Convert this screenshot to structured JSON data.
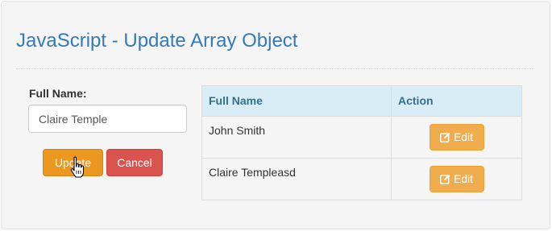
{
  "page": {
    "title": "JavaScript - Update Array Object"
  },
  "form": {
    "label": "Full Name:",
    "input_value": "Claire Temple",
    "update_label": "Update",
    "cancel_label": "Cancel"
  },
  "table": {
    "headers": [
      "Full Name",
      "Action"
    ],
    "rows": [
      {
        "name": "John Smith",
        "action_label": "Edit"
      },
      {
        "name": "Claire Templeasd",
        "action_label": "Edit"
      }
    ]
  },
  "icons": {
    "edit": "edit-icon",
    "cursor": "hand-pointer-cursor"
  },
  "colors": {
    "title": "#337ab7",
    "update": "#ec971f",
    "cancel": "#d9534f",
    "edit": "#f0ad4e",
    "table_header": "#d9edf7"
  }
}
